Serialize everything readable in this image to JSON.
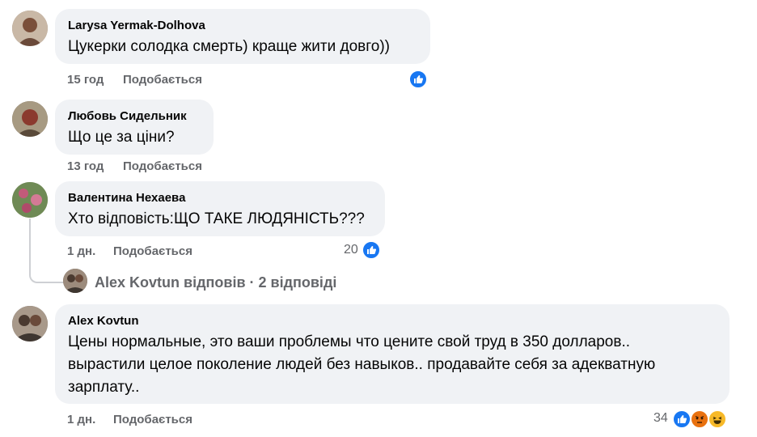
{
  "comments": [
    {
      "author": "Larysa Yermak-Dolhova",
      "lines": [
        "Цукерки солодка смерть) краще жити довго))"
      ],
      "time": "15 год",
      "like_label": "Подобається",
      "reaction_count": "",
      "reactions": [
        "like"
      ],
      "colors": {
        "avatar_bg": "#8a6e5c"
      }
    },
    {
      "author": "Любовь Сидельник",
      "lines": [
        "Що це за ціни?"
      ],
      "time": "13 год",
      "like_label": "Подобається",
      "reaction_count": "",
      "reactions": [],
      "colors": {
        "avatar_bg": "#6d5a4c"
      }
    },
    {
      "author": "Валентина Нехаева",
      "lines": [
        "Хто відповість:ЩО ТАКЕ ЛЮДЯНІСТЬ???"
      ],
      "time": "1 дн.",
      "like_label": "Подобається",
      "reaction_count": "20",
      "reactions": [
        "like"
      ],
      "replies_label": "Alex Kovtun відповів · 2 відповіді",
      "colors": {
        "avatar_bg": "#7b8a5e"
      }
    },
    {
      "author": "Alex Kovtun",
      "lines": [
        "Цены нормальные, это ваши проблемы что цените свой труд в 350 долларов..",
        "вырастили целое поколение людей без навыков.. продавайте себя за адекватную",
        "зарплату.."
      ],
      "time": "1 дн.",
      "like_label": "Подобається",
      "reaction_count": "34",
      "reactions": [
        "like",
        "angry",
        "haha"
      ],
      "colors": {
        "avatar_bg": "#5e5550"
      }
    }
  ],
  "colors": {
    "like_blue": "#1877f2",
    "bubble_bg": "#f0f2f5",
    "meta_gray": "#65676b",
    "angry_orange": "#e9710f",
    "haha_yellow": "#f7b928"
  }
}
